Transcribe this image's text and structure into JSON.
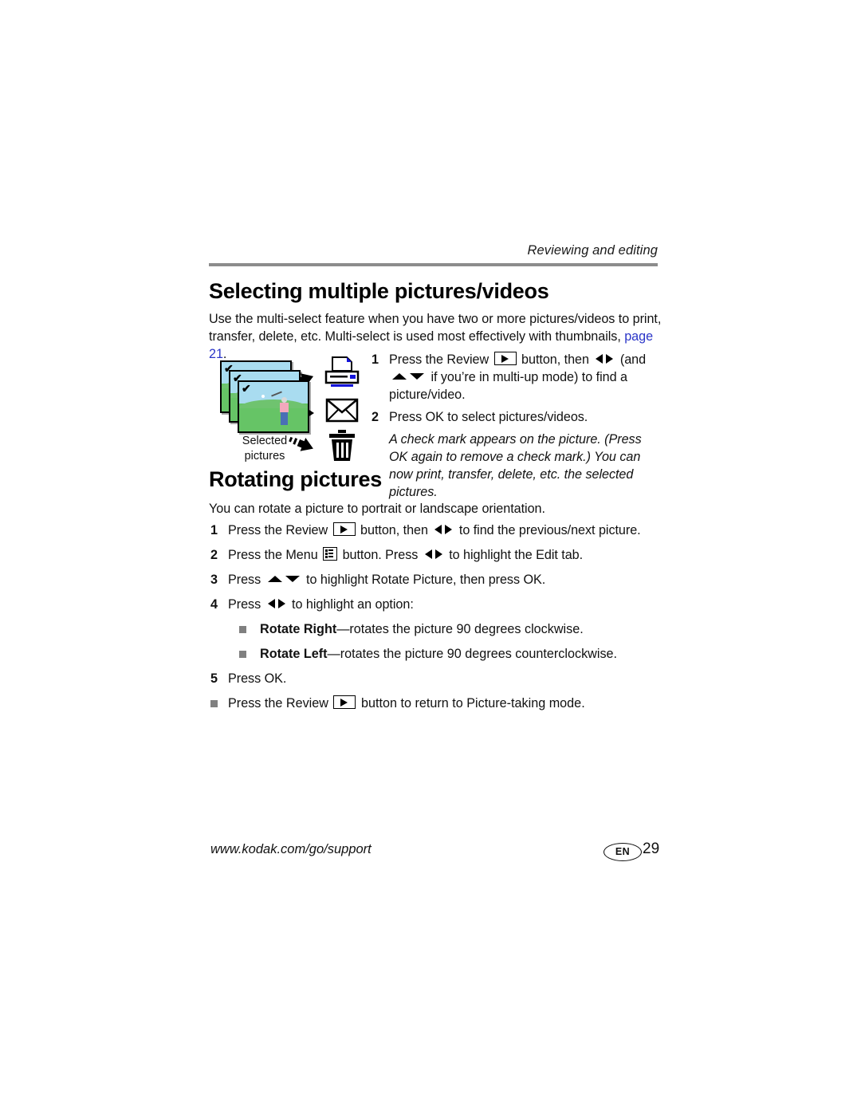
{
  "header": {
    "running_title": "Reviewing and editing"
  },
  "sections": {
    "selecting": {
      "heading": "Selecting multiple pictures/videos",
      "intro_before_link": "Use the multi-select feature when you have two or more pictures/videos to print, transfer, delete, etc. Multi-select is used most effectively with thumbnails, ",
      "intro_link": "page 21",
      "intro_after_link": ".",
      "figure": {
        "caption_line1": "Selected",
        "caption_line2": "pictures",
        "photo_checkmark": "✔",
        "icons": [
          "printer-icon",
          "envelope-icon",
          "trash-icon"
        ],
        "arrows": [
          "arrow-up-right",
          "arrow-right",
          "arrow-down-right"
        ]
      },
      "steps": [
        {
          "num": "1",
          "text_a": "Press the Review ",
          "key1": "review-button-icon",
          "text_b": " button, then ",
          "key2": "left-right-arrows",
          "text_c": " (and ",
          "key3": "up-down-arrows",
          "text_d": " if you’re in multi-up mode) to find a picture/video."
        },
        {
          "num": "2",
          "text_a": "Press OK to select pictures/videos."
        }
      ],
      "note": "A check mark appears on the picture. (Press OK again to remove a check mark.) You can now print, transfer, delete, etc. the selected pictures."
    },
    "rotating": {
      "heading": "Rotating pictures",
      "intro": "You can rotate a picture to portrait or landscape orientation.",
      "steps": [
        {
          "num": "1",
          "text_a": "Press the Review ",
          "text_b": " button, then ",
          "text_c": " to find the previous/next picture."
        },
        {
          "num": "2",
          "text_a": "Press the Menu ",
          "text_b": " button. Press ",
          "text_c": " to highlight the Edit tab."
        },
        {
          "num": "3",
          "text_a": "Press ",
          "text_b": " to highlight Rotate Picture, then press OK."
        },
        {
          "num": "4",
          "text_a": "Press ",
          "text_b": " to highlight an option:"
        },
        {
          "num": "5",
          "text_a": "Press OK."
        }
      ],
      "options": [
        {
          "label": "Rotate Right",
          "description": "—rotates the picture 90 degrees clockwise."
        },
        {
          "label": "Rotate Left",
          "description": "—rotates the picture 90 degrees counterclockwise."
        }
      ],
      "final_bullet": {
        "text_a": "Press the Review ",
        "text_b": " button to return to Picture-taking mode."
      }
    }
  },
  "footer": {
    "url": "www.kodak.com/go/support",
    "language": "EN",
    "page_number": "29"
  },
  "colors": {
    "link": "#2b35c8",
    "rule": "#8c8c8c",
    "bullet": "#808080",
    "printer_accent": "#1414dc",
    "photo_sky": "#a9dcf0",
    "photo_grass": "#66c466"
  }
}
